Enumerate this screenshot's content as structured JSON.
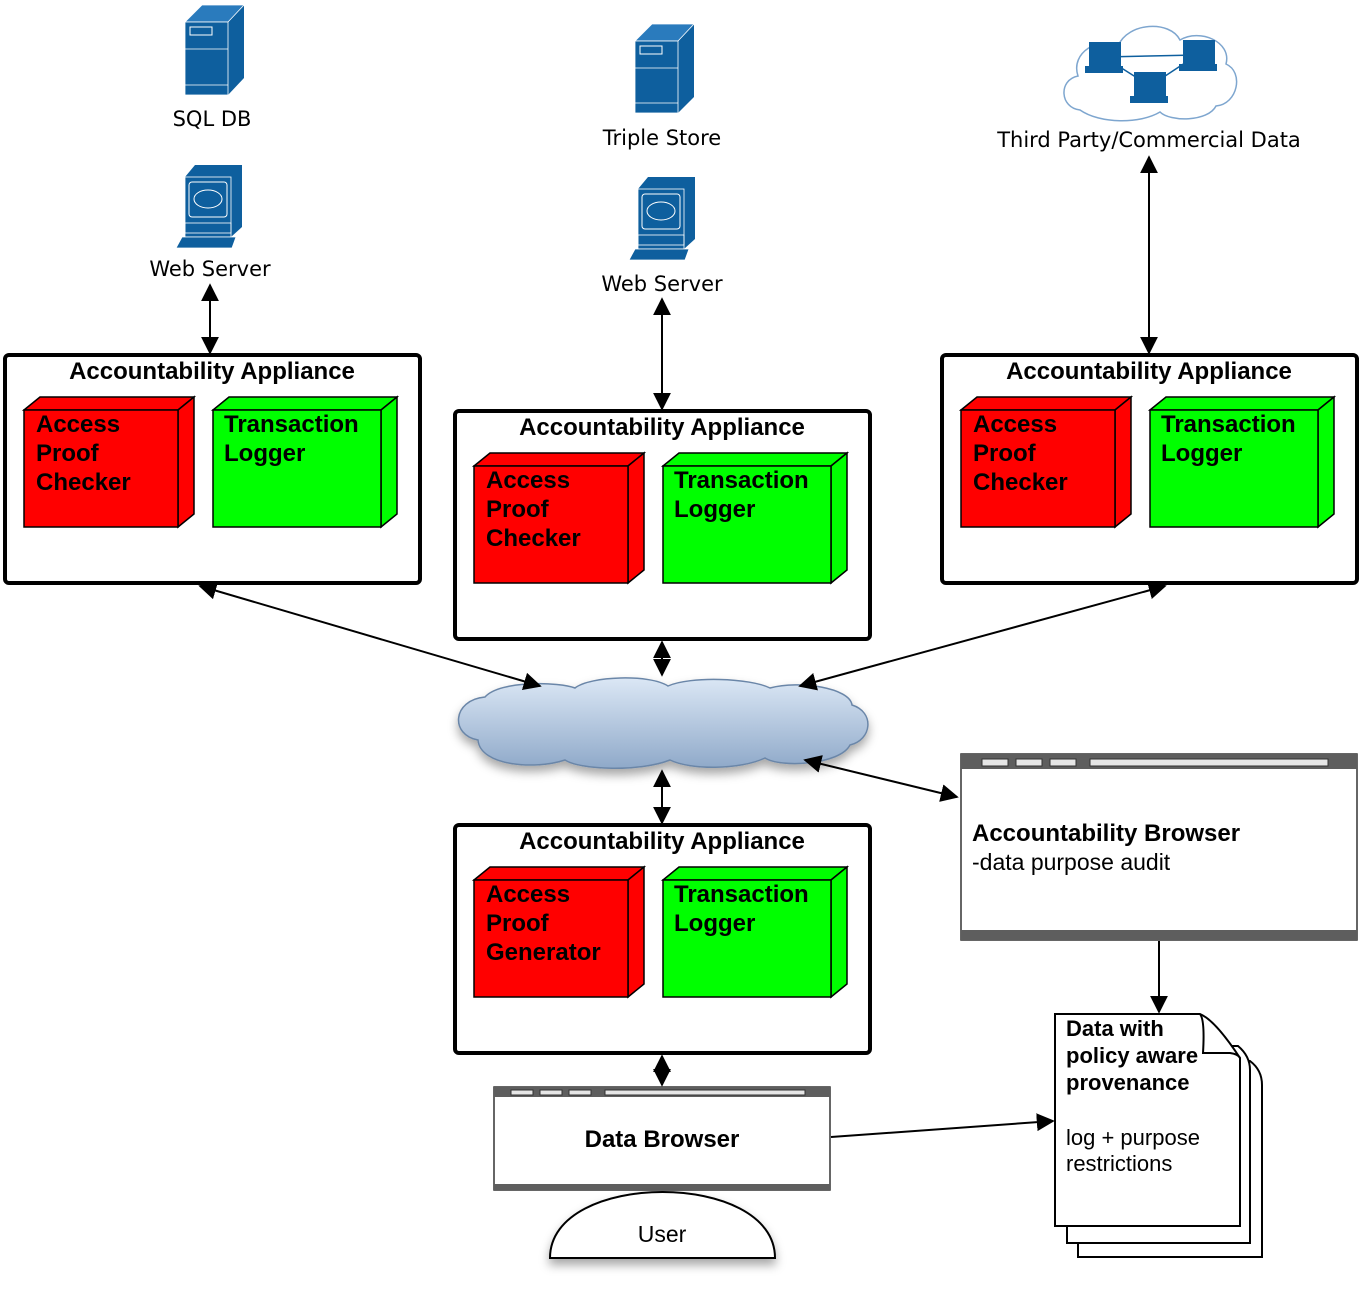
{
  "nodes": {
    "sql_db": "SQL DB",
    "web_server_1": "Web Server",
    "triple_store": "Triple Store",
    "web_server_2": "Web Server",
    "third_party": "Third Party/Commercial Data"
  },
  "appliances": [
    {
      "title": "Accountability Appliance",
      "left": [
        "Access",
        "Proof",
        "Checker"
      ],
      "right": [
        "Transaction",
        "Logger"
      ]
    },
    {
      "title": "Accountability Appliance",
      "left": [
        "Access",
        "Proof",
        "Checker"
      ],
      "right": [
        "Transaction",
        "Logger"
      ]
    },
    {
      "title": "Accountability Appliance",
      "left": [
        "Access",
        "Proof",
        "Checker"
      ],
      "right": [
        "Transaction",
        "Logger"
      ]
    },
    {
      "title": "Accountability Appliance",
      "left": [
        "Access",
        "Proof",
        "Generator"
      ],
      "right": [
        "Transaction",
        "Logger"
      ]
    }
  ],
  "accountability_browser": {
    "title": "Accountability Browser",
    "subtitle": "-data purpose audit"
  },
  "document": {
    "title": [
      "Data with",
      "policy aware",
      "provenance"
    ],
    "body": [
      "log + purpose",
      "restrictions"
    ]
  },
  "data_browser": {
    "title": "Data Browser"
  },
  "user": {
    "label": "User"
  },
  "colors": {
    "red": "#ff0000",
    "green": "#00ff00",
    "icon_blue": "#0e5f9e",
    "cloud": "#b8cde6"
  }
}
